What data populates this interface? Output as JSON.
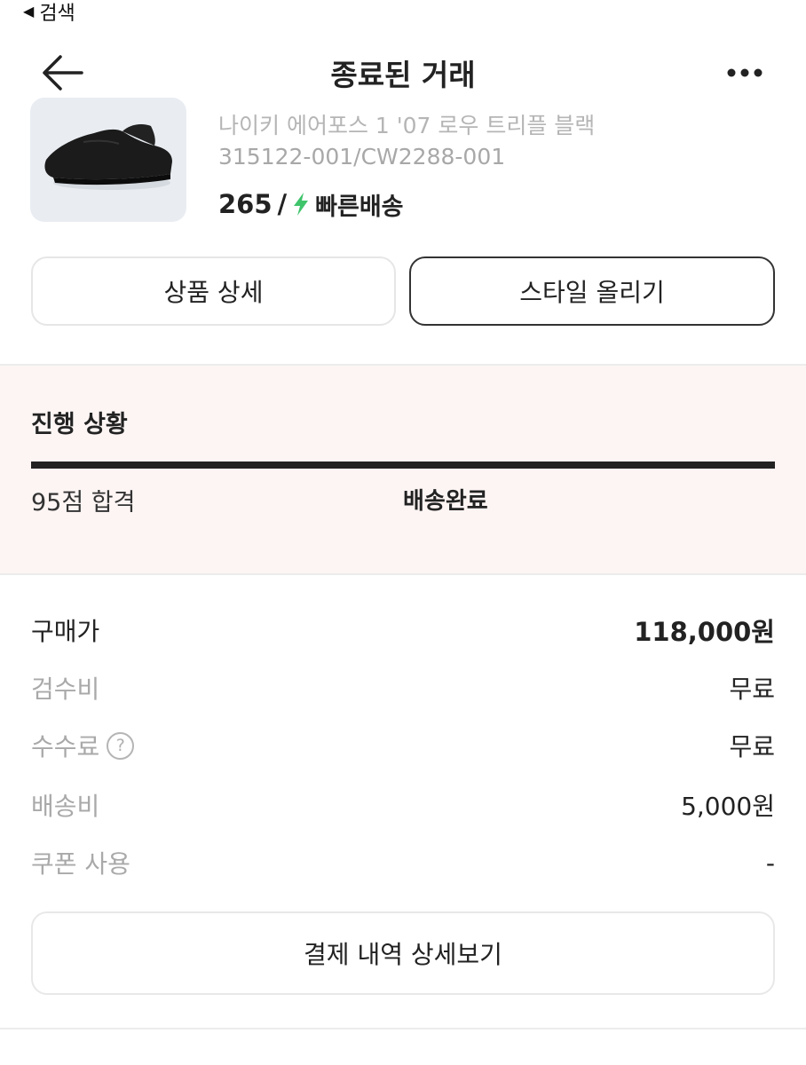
{
  "status_bar": {
    "back_label": "검색"
  },
  "navbar": {
    "title": "종료된 거래"
  },
  "product": {
    "name": "나이키 에어포스 1 '07 로우 트리플 블랙",
    "code": "315122-001/CW2288-001",
    "size": "265",
    "separator": "/",
    "delivery_label": "빠른배송",
    "bolt_color": "#3fc46b"
  },
  "buttons": {
    "product_detail": "상품 상세",
    "upload_style": "스타일 올리기",
    "payment_detail": "결제 내역 상세보기"
  },
  "progress": {
    "title": "진행 상황",
    "fill_fraction": 1.0,
    "steps": [
      "95점 합격",
      "배송완료"
    ]
  },
  "price": {
    "rows": [
      {
        "label": "구매가",
        "value": "118,000원"
      },
      {
        "label": "검수비",
        "value": "무료"
      },
      {
        "label": "수수료",
        "value": "무료",
        "help_icon": "?"
      },
      {
        "label": "배송비",
        "value": "5,000원"
      },
      {
        "label": "쿠폰 사용",
        "value": "-"
      }
    ]
  },
  "colors": {
    "progress_background": "#fdf5f4",
    "accent_dark": "#222222",
    "fast_delivery_green": "#3fc46b"
  }
}
